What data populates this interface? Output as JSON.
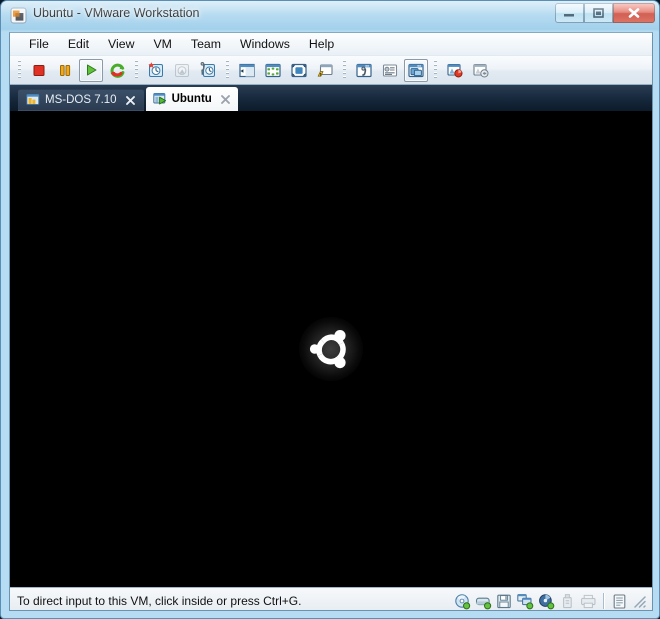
{
  "window": {
    "title": "Ubuntu - VMware Workstation",
    "app_icon": "vmware-logo-icon",
    "controls": {
      "minimize": "Minimize",
      "maximize": "Maximize",
      "close": "Close"
    },
    "accent_close": "#c5382a",
    "frame_color": "#a8d4ee"
  },
  "menubar": {
    "items": [
      {
        "label": "File"
      },
      {
        "label": "Edit"
      },
      {
        "label": "View"
      },
      {
        "label": "VM"
      },
      {
        "label": "Team"
      },
      {
        "label": "Windows"
      },
      {
        "label": "Help"
      }
    ]
  },
  "toolbar": {
    "groups": [
      {
        "name": "power",
        "buttons": [
          {
            "name": "power-off-button",
            "icon": "stop-icon",
            "state": "enabled"
          },
          {
            "name": "suspend-button",
            "icon": "pause-icon",
            "state": "enabled"
          },
          {
            "name": "power-on-button",
            "icon": "play-icon",
            "state": "active"
          },
          {
            "name": "reset-button",
            "icon": "reset-icon",
            "state": "enabled"
          }
        ]
      },
      {
        "name": "snapshot",
        "buttons": [
          {
            "name": "take-snapshot-button",
            "icon": "take-snapshot-icon",
            "state": "enabled"
          },
          {
            "name": "revert-snapshot-button",
            "icon": "revert-snapshot-icon",
            "state": "disabled"
          },
          {
            "name": "snapshot-manager-button",
            "icon": "snapshot-manager-icon",
            "state": "enabled"
          }
        ]
      },
      {
        "name": "view",
        "buttons": [
          {
            "name": "show-sidebar-button",
            "icon": "sidebar-icon",
            "state": "enabled"
          },
          {
            "name": "quick-switch-button",
            "icon": "quick-switch-icon",
            "state": "enabled"
          },
          {
            "name": "full-screen-button",
            "icon": "fullscreen-icon",
            "state": "enabled"
          },
          {
            "name": "unity-button",
            "icon": "unity-icon",
            "state": "enabled"
          }
        ]
      },
      {
        "name": "tabs",
        "buttons": [
          {
            "name": "vm-settings-button",
            "icon": "settings-wrench-icon",
            "state": "enabled"
          },
          {
            "name": "summary-view-button",
            "icon": "summary-view-icon",
            "state": "enabled"
          },
          {
            "name": "console-view-button",
            "icon": "console-view-icon",
            "state": "active"
          }
        ]
      },
      {
        "name": "appliance",
        "buttons": [
          {
            "name": "clone-vm-button",
            "icon": "clone-vm-icon",
            "state": "enabled"
          },
          {
            "name": "upload-vm-button",
            "icon": "upload-vm-icon",
            "state": "enabled"
          }
        ]
      }
    ]
  },
  "tabs": {
    "items": [
      {
        "label": "MS-DOS 7.10",
        "icon": "vm-icon",
        "active": false,
        "running": false,
        "close": "×"
      },
      {
        "label": "Ubuntu",
        "icon": "vm-running-icon",
        "active": true,
        "running": true,
        "close": "×"
      }
    ]
  },
  "console": {
    "background": "#000000",
    "splash_icon": "ubuntu-circle-of-friends-logo",
    "logo_color": "#ffffff"
  },
  "statusbar": {
    "message": "To direct input to this VM, click inside or press Ctrl+G.",
    "devices": [
      {
        "name": "cdrom-status-icon",
        "label": "CD/DVD",
        "state": "connected"
      },
      {
        "name": "harddisk-status-icon",
        "label": "Hard Disk",
        "state": "connected"
      },
      {
        "name": "floppy-status-icon",
        "label": "Floppy",
        "state": "connected"
      },
      {
        "name": "network-status-icon",
        "label": "Network Adapter",
        "state": "connected"
      },
      {
        "name": "sound-status-icon",
        "label": "Sound Card",
        "state": "connected"
      },
      {
        "name": "usb-status-icon",
        "label": "USB Controller",
        "state": "disabled"
      },
      {
        "name": "printer-status-icon",
        "label": "Printer",
        "state": "disabled"
      }
    ],
    "extra": [
      {
        "name": "message-log-icon",
        "label": "Message Log",
        "state": "enabled"
      }
    ],
    "grip": "resize-grip"
  }
}
